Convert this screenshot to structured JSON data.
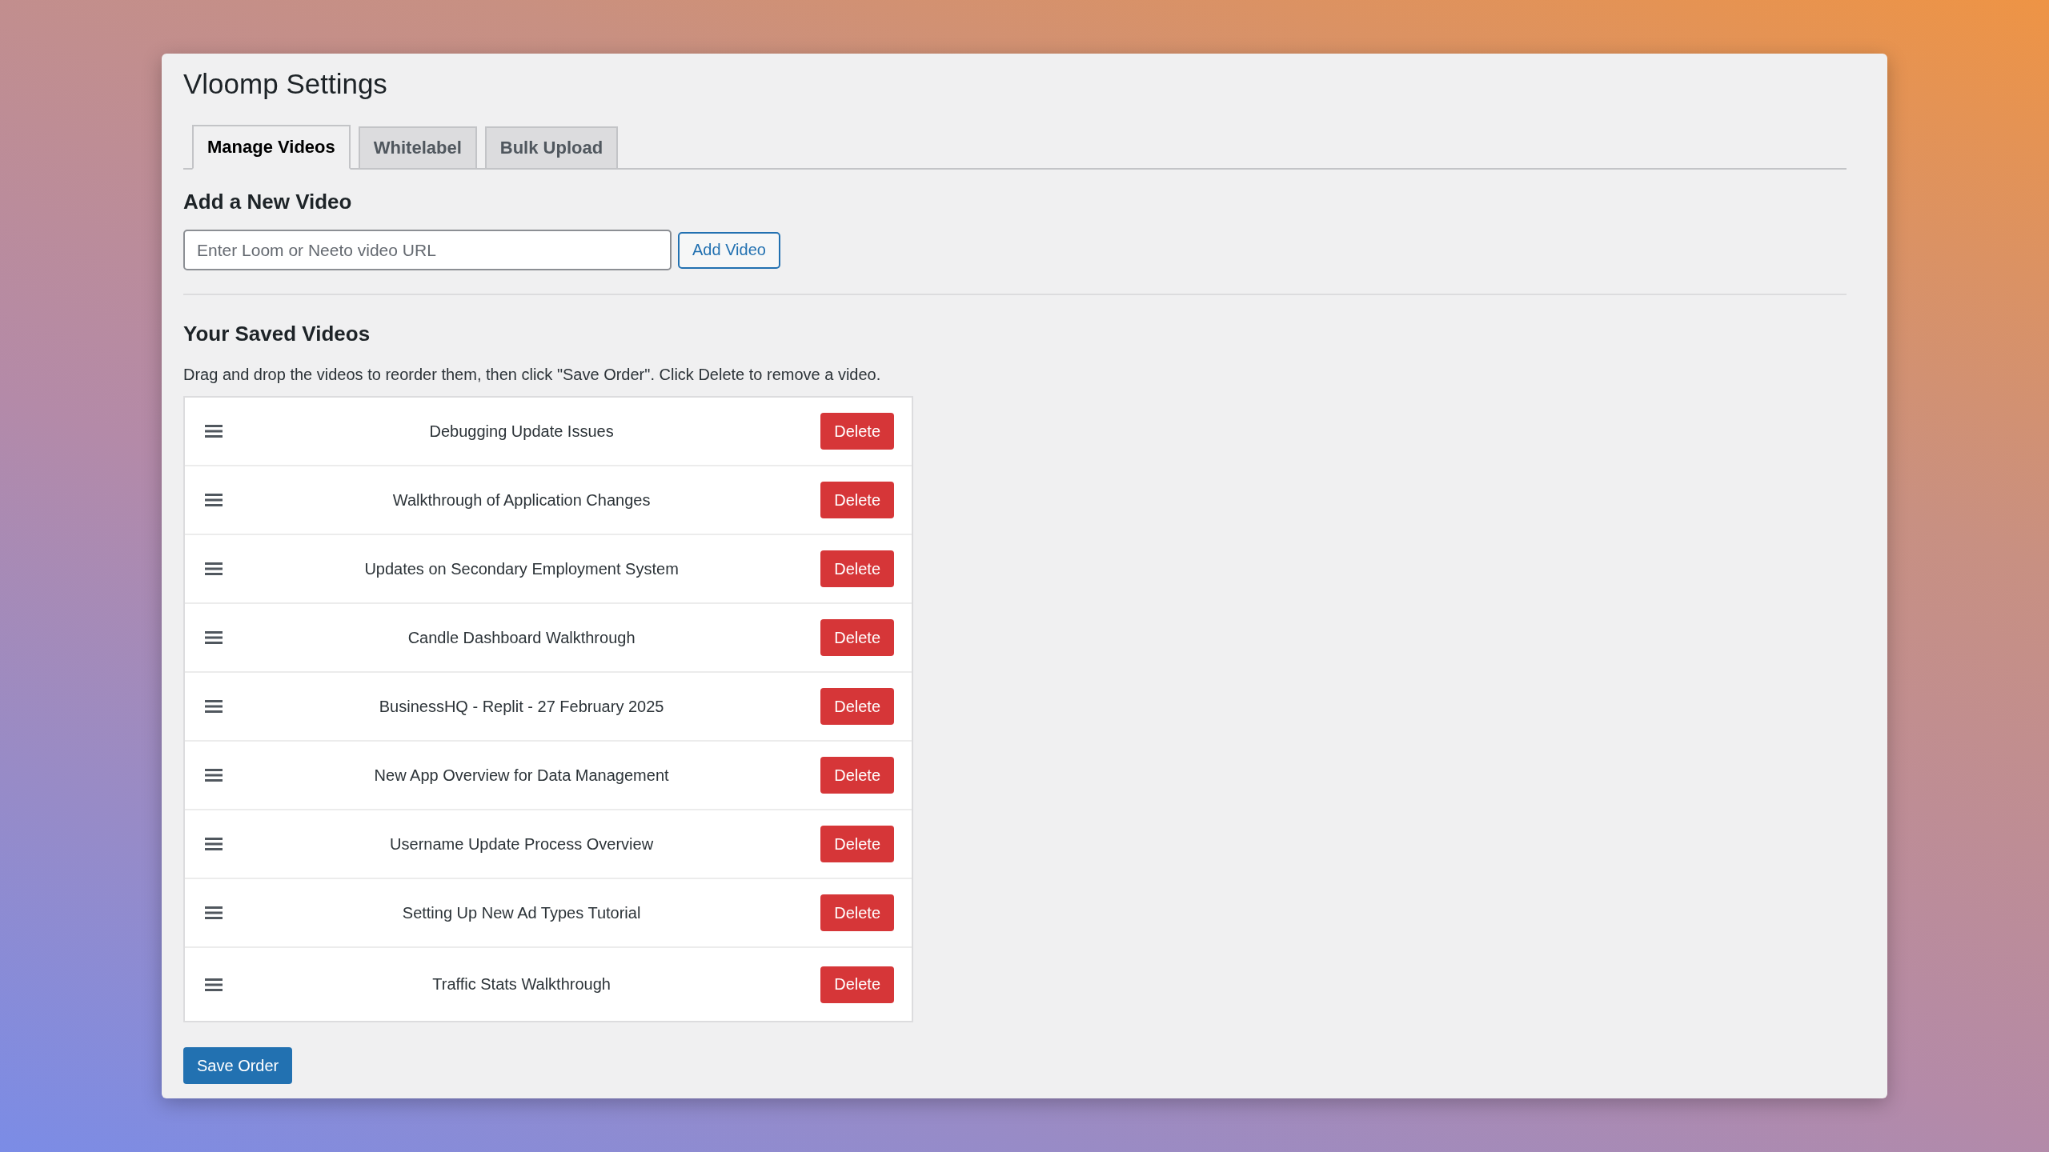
{
  "page": {
    "title": "Vloomp Settings"
  },
  "tabs": [
    {
      "label": "Manage Videos",
      "selected": true
    },
    {
      "label": "Whitelabel",
      "selected": false
    },
    {
      "label": "Bulk Upload",
      "selected": false
    }
  ],
  "add_video": {
    "heading": "Add a New Video",
    "url_field": {
      "placeholder": "Enter Loom or Neeto video URL"
    },
    "button": "Add Video"
  },
  "saved_videos": {
    "heading": "Your Saved Videos",
    "instructions": "Drag and drop the videos to reorder them, then click \"Save Order\". Click Delete to remove a video.",
    "videos": [
      {
        "title": "Debugging Update Issues",
        "action": "Delete"
      },
      {
        "title": "Walkthrough of Application Changes",
        "action": "Delete"
      },
      {
        "title": "Updates on Secondary Employment System",
        "action": "Delete"
      },
      {
        "title": "Candle Dashboard Walkthrough",
        "action": "Delete"
      },
      {
        "title": "BusinessHQ - Replit - 27 February 2025",
        "action": "Delete"
      },
      {
        "title": "New App Overview for Data Management",
        "action": "Delete"
      },
      {
        "title": "Username Update Process Overview",
        "action": "Delete"
      },
      {
        "title": "Setting Up New Ad Types Tutorial",
        "action": "Delete"
      },
      {
        "title": "Traffic Stats Walkthrough",
        "action": "Delete"
      }
    ],
    "save_button": "Save Order"
  }
}
